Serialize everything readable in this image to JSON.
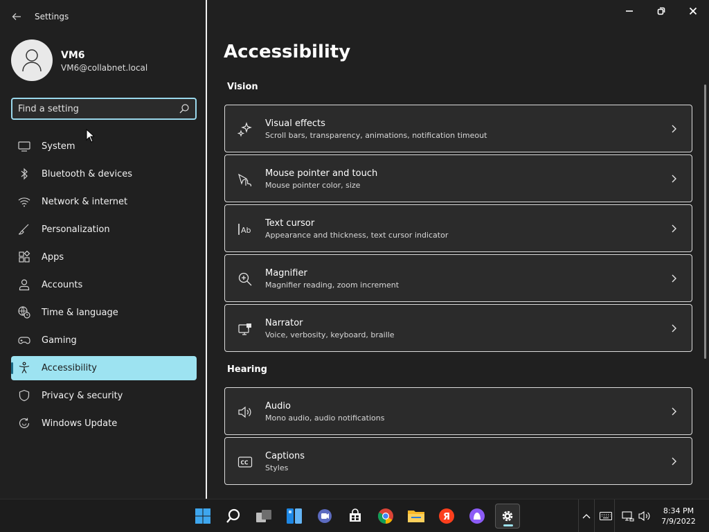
{
  "window": {
    "app_title": "Settings",
    "caption": {
      "minimize": "minimize",
      "restore": "restore",
      "close": "close"
    }
  },
  "user": {
    "name": "VM6",
    "email": "VM6@collabnet.local"
  },
  "search": {
    "placeholder": "Find a setting",
    "value": ""
  },
  "nav": [
    {
      "label": "System",
      "icon": "monitor-icon",
      "active": false
    },
    {
      "label": "Bluetooth & devices",
      "icon": "bluetooth-icon",
      "active": false
    },
    {
      "label": "Network & internet",
      "icon": "wifi-icon",
      "active": false
    },
    {
      "label": "Personalization",
      "icon": "brush-icon",
      "active": false
    },
    {
      "label": "Apps",
      "icon": "apps-icon",
      "active": false
    },
    {
      "label": "Accounts",
      "icon": "person-icon",
      "active": false
    },
    {
      "label": "Time & language",
      "icon": "globe-clock-icon",
      "active": false
    },
    {
      "label": "Gaming",
      "icon": "gamepad-icon",
      "active": false
    },
    {
      "label": "Accessibility",
      "icon": "accessibility-icon",
      "active": true
    },
    {
      "label": "Privacy & security",
      "icon": "shield-icon",
      "active": false
    },
    {
      "label": "Windows Update",
      "icon": "update-icon",
      "active": false
    }
  ],
  "page": {
    "title": "Accessibility",
    "sections": [
      {
        "title": "Vision",
        "items": [
          {
            "title": "Visual effects",
            "subtitle": "Scroll bars, transparency, animations, notification timeout",
            "icon": "sparkle-icon"
          },
          {
            "title": "Mouse pointer and touch",
            "subtitle": "Mouse pointer color, size",
            "icon": "pointer-touch-icon"
          },
          {
            "title": "Text cursor",
            "subtitle": "Appearance and thickness, text cursor indicator",
            "icon": "text-cursor-icon"
          },
          {
            "title": "Magnifier",
            "subtitle": "Magnifier reading, zoom increment",
            "icon": "magnifier-icon"
          },
          {
            "title": "Narrator",
            "subtitle": "Voice, verbosity, keyboard, braille",
            "icon": "narrator-icon"
          }
        ]
      },
      {
        "title": "Hearing",
        "items": [
          {
            "title": "Audio",
            "subtitle": "Mono audio, audio notifications",
            "icon": "speaker-icon"
          },
          {
            "title": "Captions",
            "subtitle": "Styles",
            "icon": "captions-icon"
          }
        ]
      }
    ]
  },
  "taskbar": {
    "apps": [
      "start-icon",
      "search-icon",
      "task-view-icon",
      "widgets-icon",
      "chat-icon",
      "store-icon",
      "chrome-icon",
      "file-explorer-icon",
      "yandex-icon",
      "alice-icon",
      "settings-icon"
    ],
    "active_app": "settings-icon",
    "tray_icons": [
      "chevron-up-icon",
      "keyboard-icon",
      "network-icon",
      "volume-icon"
    ],
    "time": "8:34 PM",
    "date": "7/9/2022"
  },
  "colors": {
    "accent": "#9de3f1",
    "background": "#202020",
    "card": "#2b2b2b"
  }
}
